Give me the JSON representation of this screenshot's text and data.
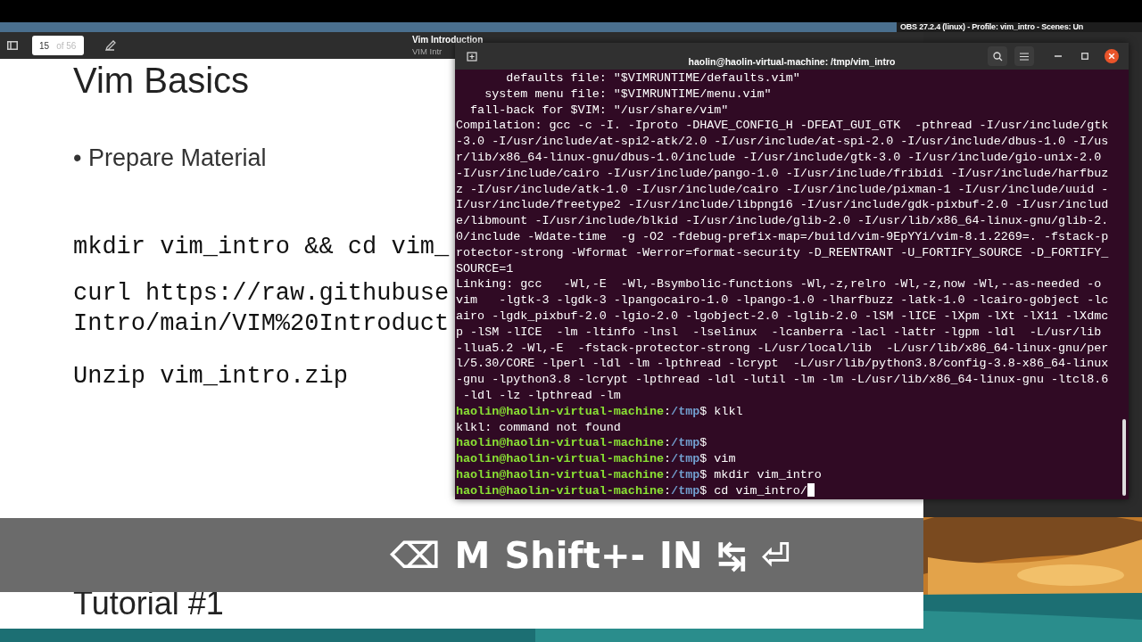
{
  "obs_window": {
    "title": "OBS 27.2.4 (linux) - Profile: vim_intro - Scenes: Un"
  },
  "viewer": {
    "page": "15",
    "page_total": "of 56",
    "title": "Vim Introduction",
    "subtitle": "VIM Intr"
  },
  "slide": {
    "title": "Vim Basics",
    "bullets": [
      "• Prepare Material"
    ],
    "commands": [
      [
        "mkdir vim_intro && cd vim_"
      ],
      [
        "curl https://raw.githubuse",
        "Intro/main/VIM%20Introduct"
      ],
      [
        "Unzip vim_intro.zip"
      ]
    ],
    "next_title": "Tutorial #1"
  },
  "terminal": {
    "title": "haolin@haolin-virtual-machine: /tmp/vim_intro",
    "lines": [
      {
        "kind": "output",
        "text": "       defaults file: \"$VIMRUNTIME/defaults.vim\""
      },
      {
        "kind": "output",
        "text": "    system menu file: \"$VIMRUNTIME/menu.vim\""
      },
      {
        "kind": "output",
        "text": "  fall-back for $VIM: \"/usr/share/vim\""
      },
      {
        "kind": "output",
        "text": "Compilation: gcc -c -I. -Iproto -DHAVE_CONFIG_H -DFEAT_GUI_GTK  -pthread -I/usr/include/gtk"
      },
      {
        "kind": "output",
        "text": "-3.0 -I/usr/include/at-spi2-atk/2.0 -I/usr/include/at-spi-2.0 -I/usr/include/dbus-1.0 -I/us"
      },
      {
        "kind": "output",
        "text": "r/lib/x86_64-linux-gnu/dbus-1.0/include -I/usr/include/gtk-3.0 -I/usr/include/gio-unix-2.0"
      },
      {
        "kind": "output",
        "text": "-I/usr/include/cairo -I/usr/include/pango-1.0 -I/usr/include/fribidi -I/usr/include/harfbuz"
      },
      {
        "kind": "output",
        "text": "z -I/usr/include/atk-1.0 -I/usr/include/cairo -I/usr/include/pixman-1 -I/usr/include/uuid -"
      },
      {
        "kind": "output",
        "text": "I/usr/include/freetype2 -I/usr/include/libpng16 -I/usr/include/gdk-pixbuf-2.0 -I/usr/includ"
      },
      {
        "kind": "output",
        "text": "e/libmount -I/usr/include/blkid -I/usr/include/glib-2.0 -I/usr/lib/x86_64-linux-gnu/glib-2."
      },
      {
        "kind": "output",
        "text": "0/include -Wdate-time  -g -O2 -fdebug-prefix-map=/build/vim-9EpYYi/vim-8.1.2269=. -fstack-p"
      },
      {
        "kind": "output",
        "text": "rotector-strong -Wformat -Werror=format-security -D_REENTRANT -U_FORTIFY_SOURCE -D_FORTIFY_"
      },
      {
        "kind": "output",
        "text": "SOURCE=1"
      },
      {
        "kind": "output",
        "text": "Linking: gcc   -Wl,-E  -Wl,-Bsymbolic-functions -Wl,-z,relro -Wl,-z,now -Wl,--as-needed -o"
      },
      {
        "kind": "output",
        "text": "vim   -lgtk-3 -lgdk-3 -lpangocairo-1.0 -lpango-1.0 -lharfbuzz -latk-1.0 -lcairo-gobject -lc"
      },
      {
        "kind": "output",
        "text": "airo -lgdk_pixbuf-2.0 -lgio-2.0 -lgobject-2.0 -lglib-2.0 -lSM -lICE -lXpm -lXt -lX11 -lXdmc"
      },
      {
        "kind": "output",
        "text": "p -lSM -lICE  -lm -ltinfo -lnsl  -lselinux  -lcanberra -lacl -lattr -lgpm -ldl  -L/usr/lib"
      },
      {
        "kind": "output",
        "text": "-llua5.2 -Wl,-E  -fstack-protector-strong -L/usr/local/lib  -L/usr/lib/x86_64-linux-gnu/per"
      },
      {
        "kind": "output",
        "text": "l/5.30/CORE -lperl -ldl -lm -lpthread -lcrypt  -L/usr/lib/python3.8/config-3.8-x86_64-linux"
      },
      {
        "kind": "output",
        "text": "-gnu -lpython3.8 -lcrypt -lpthread -ldl -lutil -lm -lm -L/usr/lib/x86_64-linux-gnu -ltcl8.6"
      },
      {
        "kind": "output",
        "text": " -ldl -lz -lpthread -lm"
      },
      {
        "kind": "prompt",
        "user": "haolin@haolin-virtual-machine",
        "colon": ":",
        "path": "/tmp",
        "dollar": "$",
        "command": "klkl",
        "cursor": false
      },
      {
        "kind": "output",
        "text": "klkl: command not found"
      },
      {
        "kind": "prompt",
        "user": "haolin@haolin-virtual-machine",
        "colon": ":",
        "path": "/tmp",
        "dollar": "$",
        "cursor": false
      },
      {
        "kind": "prompt",
        "user": "haolin@haolin-virtual-machine",
        "colon": ":",
        "path": "/tmp",
        "dollar": "$",
        "command": "vim",
        "cursor": false
      },
      {
        "kind": "prompt",
        "user": "haolin@haolin-virtual-machine",
        "colon": ":",
        "path": "/tmp",
        "dollar": "$",
        "command": "mkdir vim_intro",
        "cursor": false
      },
      {
        "kind": "prompt",
        "user": "haolin@haolin-virtual-machine",
        "colon": ":",
        "path": "/tmp",
        "dollar": "$",
        "command": "cd vim_intro/",
        "cursor": true
      }
    ]
  },
  "key_overlay": {
    "keys": [
      "⌫",
      "M",
      "Shift+-",
      "IN",
      "↹",
      "⏎"
    ]
  }
}
